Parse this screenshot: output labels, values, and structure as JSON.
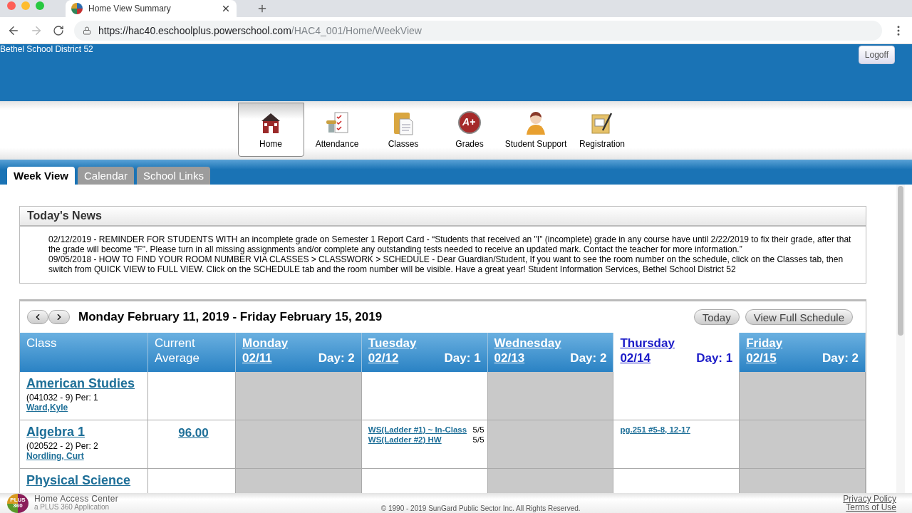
{
  "browser": {
    "tab_title": "Home View Summary",
    "url_host": "https://hac40.eschoolplus.powerschool.com",
    "url_path": "/HAC4_001/Home/WeekView"
  },
  "header": {
    "logo_alt": "Bethel School District 52",
    "logoff": "Logoff"
  },
  "nav": [
    {
      "label": "Home",
      "kind": "home",
      "selected": true
    },
    {
      "label": "Attendance",
      "kind": "attendance",
      "selected": false
    },
    {
      "label": "Classes",
      "kind": "classes",
      "selected": false
    },
    {
      "label": "Grades",
      "kind": "grades",
      "selected": false,
      "badge": "A+"
    },
    {
      "label": "Student Support",
      "kind": "support",
      "selected": false
    },
    {
      "label": "Registration",
      "kind": "registration",
      "selected": false
    }
  ],
  "tabs": [
    {
      "label": "Week View",
      "selected": true
    },
    {
      "label": "Calendar",
      "selected": false
    },
    {
      "label": "School Links",
      "selected": false
    }
  ],
  "news": {
    "title": "Today's News",
    "items": [
      "02/12/2019 - REMINDER FOR STUDENTS WITH an incomplete grade on Semester 1 Report Card - “Students that received an \"I\" (incomplete) grade in any course have until 2/22/2019 to fix their grade, after that the grade will become \"F\". Please turn in all missing assignments and/or complete any outstanding tests needed to receive an updated mark. Contact the teacher for more information.”",
      "09/05/2018 - HOW TO FIND YOUR ROOM NUMBER VIA CLASSES > CLASSWORK > SCHEDULE - Dear Guardian/Student, If you want to see the room number on the schedule, click on the Classes tab, then switch from QUICK VIEW to FULL VIEW. Click on the SCHEDULE tab and the room number will be visible. Have a great year! Student Information Services, Bethel School District 52"
    ]
  },
  "schedule": {
    "range": "Monday February 11, 2019 - Friday February 15, 2019",
    "buttons": [
      "Today",
      "View Full Schedule"
    ],
    "columns": [
      "Class",
      "Current Average"
    ],
    "days": [
      {
        "name": "Monday",
        "date": "02/11",
        "day": "Day: 2",
        "selected": false,
        "shaded": true
      },
      {
        "name": "Tuesday",
        "date": "02/12",
        "day": "Day: 1",
        "selected": false,
        "shaded": false
      },
      {
        "name": "Wednesday",
        "date": "02/13",
        "day": "Day: 2",
        "selected": false,
        "shaded": true
      },
      {
        "name": "Thursday",
        "date": "02/14",
        "day": "Day: 1",
        "selected": true,
        "shaded": false
      },
      {
        "name": "Friday",
        "date": "02/15",
        "day": "Day: 2",
        "selected": false,
        "shaded": true
      }
    ],
    "rows": [
      {
        "class": "American Studies",
        "code": "(041032 - 9) Per: 1",
        "teacher": "Ward,Kyle",
        "cells": [
          [],
          [],
          [],
          [],
          []
        ]
      },
      {
        "class": "Algebra 1",
        "code": "(020522 - 2) Per: 2",
        "teacher": "Nordling, Curt",
        "average": "96.00",
        "cells": [
          [],
          [
            {
              "title": "WS(Ladder #1) ~ In-Class",
              "score": "5/5"
            },
            {
              "title": "WS(Ladder #2) HW",
              "score": "5/5"
            }
          ],
          [],
          [
            {
              "title": "pg.251 #5-8, 12-17"
            }
          ],
          []
        ]
      },
      {
        "class": "Physical Science",
        "cells": [
          [],
          [],
          [],
          [],
          []
        ]
      }
    ]
  },
  "footer": {
    "logo_text": "PLUS 360",
    "app": "Home Access Center",
    "sub": "a PLUS 360 Application",
    "copyright": "© 1990 - 2019 SunGard Public Sector Inc. All Rights Reserved.",
    "links": [
      "Privacy Policy",
      "Terms of Use"
    ]
  }
}
